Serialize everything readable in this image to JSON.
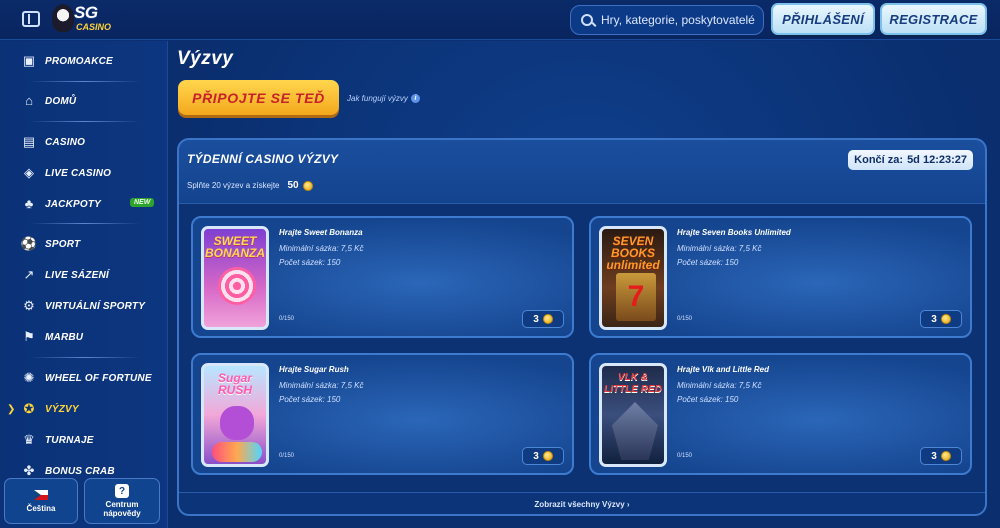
{
  "header": {
    "logo_main": "SG",
    "logo_sub": "CASINO",
    "search_placeholder": "Hry, kategorie, poskytovatelé",
    "login_label": "PŘIHLÁŠENÍ",
    "register_label": "REGISTRACE"
  },
  "sidebar": {
    "items": [
      {
        "label": "PROMOAKCE",
        "icon": "gift-icon"
      },
      {
        "label": "DOMŮ",
        "icon": "home-icon"
      },
      {
        "label": "CASINO",
        "icon": "slot-machine-icon"
      },
      {
        "label": "LIVE CASINO",
        "icon": "shield-card-icon"
      },
      {
        "label": "JACKPOTY",
        "icon": "clover-icon",
        "badge": "NEW"
      },
      {
        "label": "SPORT",
        "icon": "soccer-ball-icon"
      },
      {
        "label": "LIVE SÁZENÍ",
        "icon": "live-chart-icon"
      },
      {
        "label": "VIRTUÁLNÍ SPORTY",
        "icon": "virtual-sports-icon"
      },
      {
        "label": "MARBU",
        "icon": "checkered-flag-icon"
      },
      {
        "label": "WHEEL OF FORTUNE",
        "icon": "wheel-icon"
      },
      {
        "label": "VÝZVY",
        "icon": "medal-icon",
        "active": true
      },
      {
        "label": "TURNAJE",
        "icon": "trophy-icon"
      },
      {
        "label": "BONUS CRAB",
        "icon": "crab-icon"
      }
    ],
    "language_label": "Čeština",
    "help_label_1": "Centrum",
    "help_label_2": "nápovědy"
  },
  "main": {
    "title": "Výzvy",
    "join_label": "PŘIPOJTE SE TEĎ",
    "how_link": "Jak fungují výzvy",
    "panel": {
      "title": "TÝDENNÍ CASINO VÝZVY",
      "subtitle": "Splňte 20 výzev a získejte",
      "reward": "50",
      "timer_label": "Končí za:",
      "timer_value": "5d 12:23:27",
      "show_all": "Zobrazit všechny Výzvy ›"
    },
    "cards": [
      {
        "title": "Hrajte Sweet Bonanza",
        "min_bet": "Minimální sázka: 7,5 Kč",
        "count": "Počet sázek: 150",
        "progress": "0/150",
        "reward": "3",
        "thumb_text": "SWEET BONANZA"
      },
      {
        "title": "Hrajte Seven Books Unlimited",
        "min_bet": "Minimální sázka: 7,5 Kč",
        "count": "Počet sázek: 150",
        "progress": "0/150",
        "reward": "3",
        "thumb_text": "SEVEN BOOKS unlimited"
      },
      {
        "title": "Hrajte Sugar Rush",
        "min_bet": "Minimální sázka: 7,5 Kč",
        "count": "Počet sázek: 150",
        "progress": "0/150",
        "reward": "3",
        "thumb_text": "Sugar RUSH"
      },
      {
        "title": "Hrajte Vlk and Little Red",
        "min_bet": "Minimální sázka: 7,5 Kč",
        "count": "Počet sázek: 150",
        "progress": "0/150",
        "reward": "3",
        "thumb_text": "VLK & LITTLE RED"
      }
    ]
  },
  "colors": {
    "background": "#0b2f72",
    "accent_yellow": "#ffd53a",
    "join_button": "#f4a81c",
    "join_text": "#c8212a",
    "new_badge": "#2ea42e"
  }
}
